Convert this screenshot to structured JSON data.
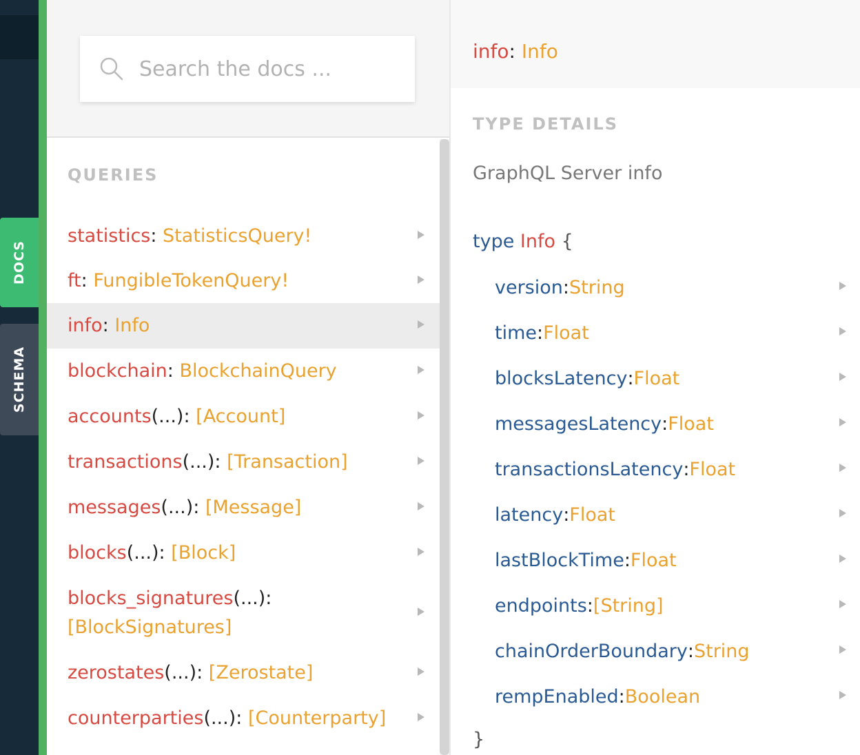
{
  "sidebar": {
    "tabs": [
      {
        "label": "DOCS",
        "active": true
      },
      {
        "label": "SCHEMA",
        "active": false
      }
    ]
  },
  "search": {
    "placeholder": "Search the docs ...",
    "value": ""
  },
  "queries": {
    "title": "QUERIES",
    "items": [
      {
        "name": "statistics",
        "args": "",
        "type": "StatisticsQuery!"
      },
      {
        "name": "ft",
        "args": "",
        "type": "FungibleTokenQuery!"
      },
      {
        "name": "info",
        "args": "",
        "type": "Info",
        "active": true
      },
      {
        "name": "blockchain",
        "args": "",
        "type": "BlockchainQuery"
      },
      {
        "name": "accounts",
        "args": "(...)",
        "type": "[Account]"
      },
      {
        "name": "transactions",
        "args": "(...)",
        "type": "[Transaction]"
      },
      {
        "name": "messages",
        "args": "(...)",
        "type": "[Message]"
      },
      {
        "name": "blocks",
        "args": "(...)",
        "type": "[Block]"
      },
      {
        "name": "blocks_signatures",
        "args": "(...)",
        "type": "[BlockSignatures]"
      },
      {
        "name": "zerostates",
        "args": "(...)",
        "type": "[Zerostate]"
      },
      {
        "name": "counterparties",
        "args": "(...)",
        "type": "[Counterparty]"
      }
    ]
  },
  "detail": {
    "field_name": "info",
    "field_type": "Info",
    "section_title": "TYPE DETAILS",
    "description": "GraphQL Server info",
    "keyword": "type",
    "type_name": "Info",
    "open_brace": "{",
    "close_brace": "}",
    "fields": [
      {
        "name": "version",
        "type": "String"
      },
      {
        "name": "time",
        "type": "Float"
      },
      {
        "name": "blocksLatency",
        "type": "Float"
      },
      {
        "name": "messagesLatency",
        "type": "Float"
      },
      {
        "name": "transactionsLatency",
        "type": "Float"
      },
      {
        "name": "latency",
        "type": "Float"
      },
      {
        "name": "lastBlockTime",
        "type": "Float"
      },
      {
        "name": "endpoints",
        "type": "[String]"
      },
      {
        "name": "chainOrderBoundary",
        "type": "String"
      },
      {
        "name": "rempEnabled",
        "type": "Boolean"
      }
    ]
  }
}
